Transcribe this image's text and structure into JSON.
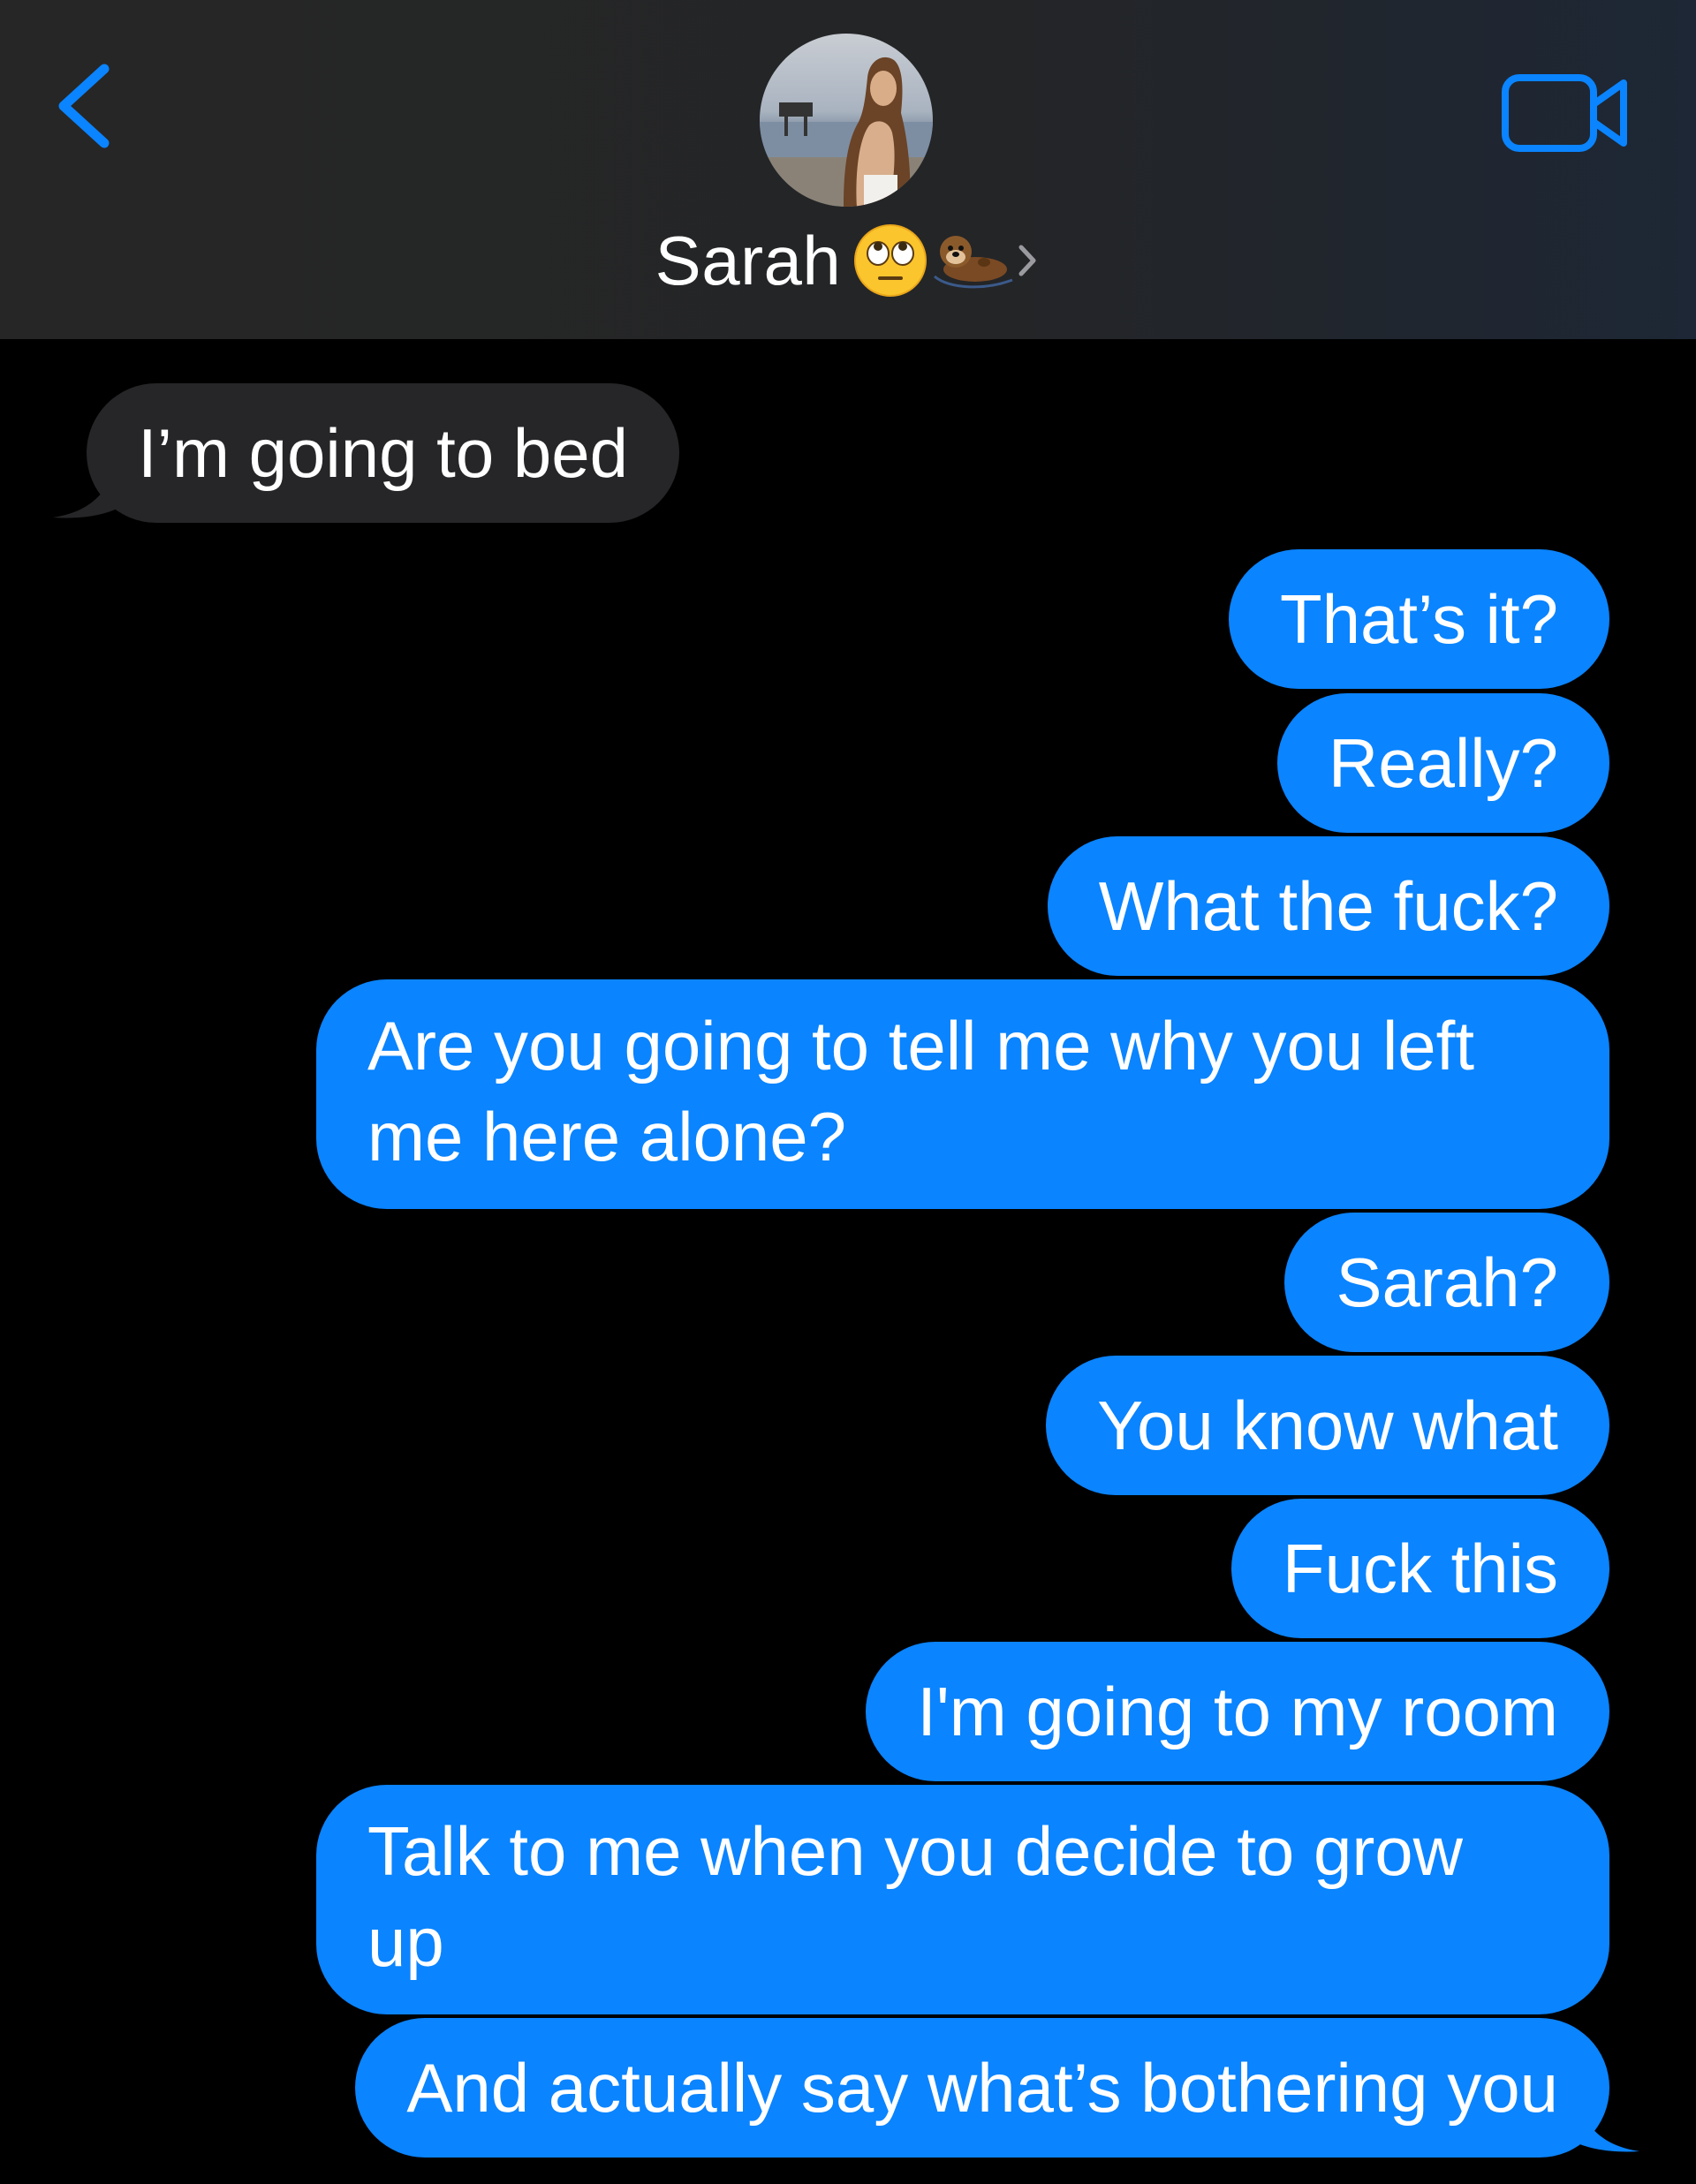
{
  "header": {
    "contact_name": "Sarah",
    "contact_emojis": [
      "face-with-rolling-eyes",
      "otter"
    ],
    "accent_color": "#0a84ff"
  },
  "messages": [
    {
      "direction": "incoming",
      "text": "I’m going to bed"
    },
    {
      "direction": "outgoing",
      "text": "That’s it?"
    },
    {
      "direction": "outgoing",
      "text": "Really?"
    },
    {
      "direction": "outgoing",
      "text": "What the fuck?"
    },
    {
      "direction": "outgoing",
      "text": "Are you going to tell me why you left me here alone?"
    },
    {
      "direction": "outgoing",
      "text": "Sarah?"
    },
    {
      "direction": "outgoing",
      "text": "You know what"
    },
    {
      "direction": "outgoing",
      "text": "Fuck this"
    },
    {
      "direction": "outgoing",
      "text": "I'm going to my room"
    },
    {
      "direction": "outgoing",
      "text": "Talk to me when you decide to grow up"
    },
    {
      "direction": "outgoing",
      "text": "And actually say what’s bothering you"
    }
  ],
  "colors": {
    "outgoing_bubble": "#0a84ff",
    "incoming_bubble": "#262628",
    "background": "#000000",
    "header_background": "#262626"
  }
}
